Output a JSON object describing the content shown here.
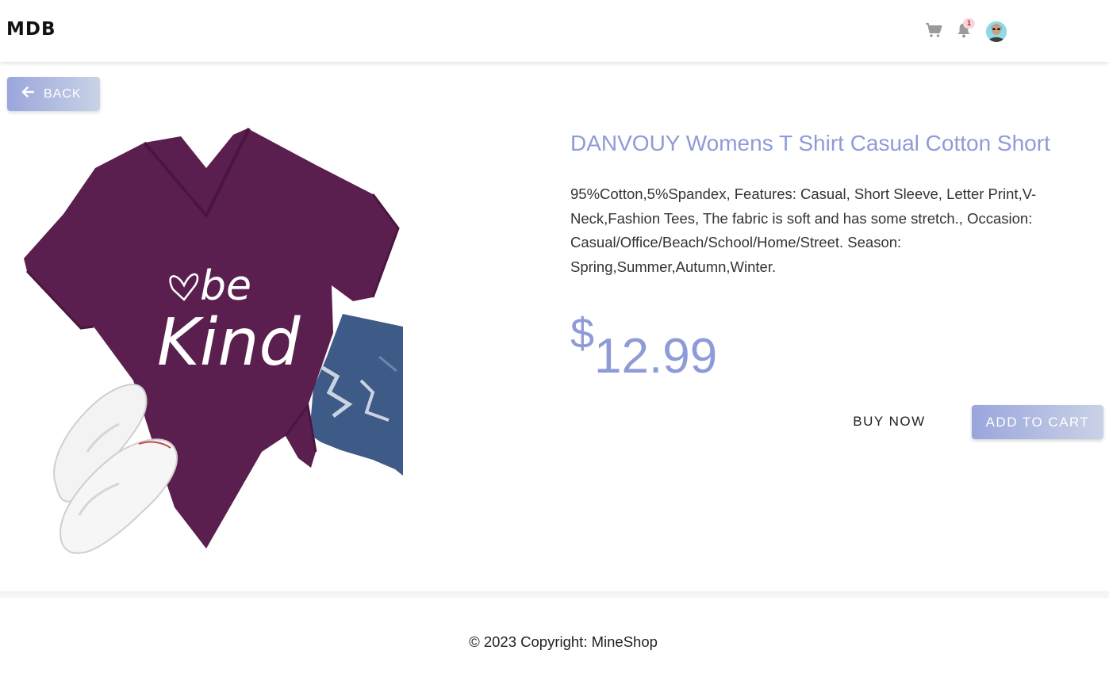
{
  "navbar": {
    "brand": "MDB",
    "cart_icon": "shopping-cart-icon",
    "bell_icon": "bell-icon",
    "notification_count": "1",
    "avatar": "user-avatar"
  },
  "back_button": {
    "label": "BACK",
    "icon": "arrow-left-icon"
  },
  "product": {
    "image_icon": "tshirt-product-image",
    "image_text_line1": "be",
    "image_text_line2": "Kind",
    "title": "DANVOUY Womens T Shirt Casual Cotton Short",
    "description": "95%Cotton,5%Spandex, Features: Casual, Short Sleeve, Letter Print,V-Neck,Fashion Tees, The fabric is soft and has some stretch., Occasion: Casual/Office/Beach/School/Home/Street. Season: Spring,Summer,Autumn,Winter.",
    "currency": "$",
    "price": "12.99",
    "buy_now_label": "BUY NOW",
    "add_to_cart_label": "ADD TO CART"
  },
  "footer": {
    "text": "© 2023 Copyright: MineShop"
  },
  "colors": {
    "accent": "#8e9bd8",
    "button_gradient_start": "#9aa6dc",
    "button_gradient_end": "#c9d2e6",
    "badge_bg": "#f7d6dc",
    "shirt": "#5b1f4f"
  }
}
